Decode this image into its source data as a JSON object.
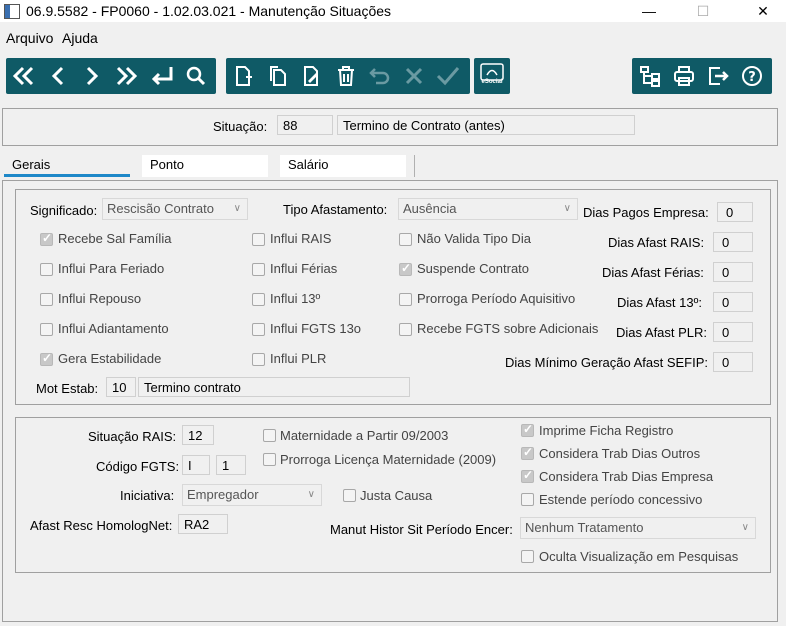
{
  "window": {
    "title": "06.9.5582 - FP0060 - 1.02.03.021 - Manutenção Situações",
    "min": "—",
    "max": "☐",
    "close": "✕"
  },
  "menu": [
    "Arquivo",
    "Ajuda"
  ],
  "toolbar": {
    "esocial_label": "eSocial"
  },
  "header": {
    "situacao_label": "Situação:",
    "situacao_code": "88",
    "situacao_desc": "Termino de Contrato (antes)"
  },
  "tabs": [
    "Gerais",
    "Ponto",
    "Salário"
  ],
  "gerais": {
    "significado_label": "Significado:",
    "significado_value": "Rescisão Contrato",
    "tipo_afast_label": "Tipo Afastamento:",
    "tipo_afast_value": "Ausência",
    "checks": [
      {
        "label": "Recebe Sal Família",
        "checked": true
      },
      {
        "label": "Influi Para Feriado",
        "checked": false
      },
      {
        "label": "Influi Repouso",
        "checked": false
      },
      {
        "label": "Influi Adiantamento",
        "checked": false
      },
      {
        "label": "Gera Estabilidade",
        "checked": true
      },
      {
        "label": "Influi RAIS",
        "checked": false
      },
      {
        "label": "Influi Férias",
        "checked": false
      },
      {
        "label": "Influi 13º",
        "checked": false
      },
      {
        "label": "Influi FGTS 13o",
        "checked": false
      },
      {
        "label": "Influi PLR",
        "checked": false
      },
      {
        "label": "Não Valida Tipo Dia",
        "checked": false
      },
      {
        "label": "Suspende Contrato",
        "checked": true
      },
      {
        "label": "Prorroga Período Aquisitivo",
        "checked": false
      },
      {
        "label": "Recebe FGTS sobre Adicionais",
        "checked": false
      }
    ],
    "dias": [
      {
        "label": "Dias Pagos Empresa:",
        "value": "0"
      },
      {
        "label": "Dias Afast RAIS:",
        "value": "0"
      },
      {
        "label": "Dias Afast Férias:",
        "value": "0"
      },
      {
        "label": "Dias Afast 13º:",
        "value": "0"
      },
      {
        "label": "Dias Afast PLR:",
        "value": "0"
      },
      {
        "label": "Dias Mínimo Geração Afast SEFIP:",
        "value": "0"
      }
    ],
    "mot_estab_label": "Mot Estab:",
    "mot_estab_code": "10",
    "mot_estab_desc": "Termino contrato"
  },
  "lower": {
    "sit_rais_label": "Situação RAIS:",
    "sit_rais_value": "12",
    "cod_fgts_label": "Código FGTS:",
    "cod_fgts_a": "I",
    "cod_fgts_b": "1",
    "iniciativa_label": "Iniciativa:",
    "iniciativa_value": "Empregador",
    "afast_label": "Afast Resc HomologNet:",
    "afast_value": "RA2",
    "checks_mid": [
      {
        "label": "Maternidade a Partir 09/2003",
        "checked": false
      },
      {
        "label": "Prorroga Licença Maternidade (2009)",
        "checked": false
      },
      {
        "label": "Justa Causa",
        "checked": false
      }
    ],
    "checks_right": [
      {
        "label": "Imprime Ficha Registro",
        "checked": true
      },
      {
        "label": "Considera Trab Dias Outros",
        "checked": true
      },
      {
        "label": "Considera Trab Dias Empresa",
        "checked": true
      },
      {
        "label": "Estende período concessivo",
        "checked": false
      }
    ],
    "manut_label": "Manut Histor Sit Período Encer:",
    "manut_value": "Nenhum Tratamento",
    "oculta": {
      "label": "Oculta Visualização em Pesquisas",
      "checked": false
    }
  }
}
